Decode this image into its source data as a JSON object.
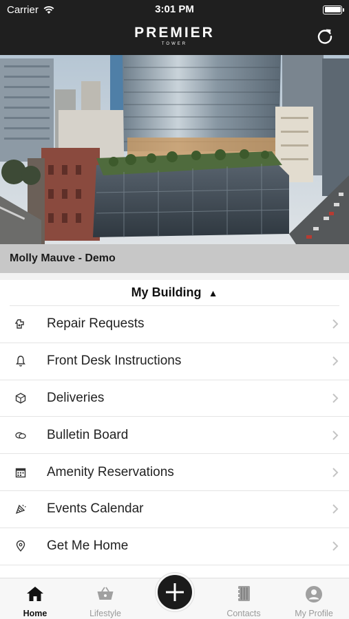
{
  "status_bar": {
    "carrier": "Carrier",
    "time": "3:01 PM"
  },
  "header": {
    "brand_name": "PREMIER",
    "brand_sub": "TOWER"
  },
  "user_bar": {
    "label": "Molly Mauve - Demo"
  },
  "section": {
    "title": "My Building"
  },
  "menu": [
    {
      "label": "Repair Requests",
      "icon": "repair-icon"
    },
    {
      "label": "Front Desk Instructions",
      "icon": "bell-icon"
    },
    {
      "label": "Deliveries",
      "icon": "package-icon"
    },
    {
      "label": "Bulletin Board",
      "icon": "chat-icon"
    },
    {
      "label": "Amenity Reservations",
      "icon": "calendar-icon"
    },
    {
      "label": "Events Calendar",
      "icon": "party-icon"
    },
    {
      "label": "Get Me Home",
      "icon": "location-pin-icon"
    }
  ],
  "tabbar": {
    "home": "Home",
    "lifestyle": "Lifestyle",
    "contacts": "Contacts",
    "profile": "My Profile"
  },
  "colors": {
    "header_bg": "#1f1f1f",
    "user_bar_bg": "#c7c7c7",
    "tab_active": "#111111",
    "tab_inactive": "#9a9a9a"
  }
}
